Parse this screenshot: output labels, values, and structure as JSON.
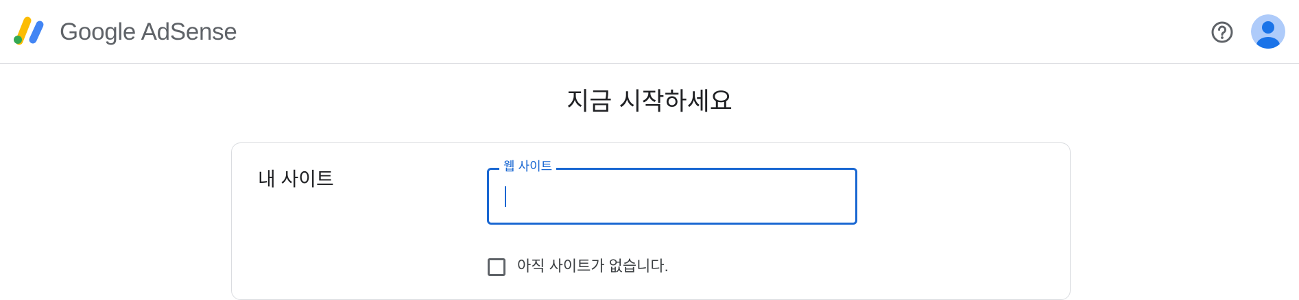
{
  "header": {
    "brand_google": "Google",
    "brand_product": "AdSense",
    "help_icon": "help-circle-icon",
    "avatar_icon": "account-avatar-icon"
  },
  "main": {
    "title": "지금 시작하세요"
  },
  "site_section": {
    "label": "내 사이트",
    "website_field": {
      "label": "웹 사이트",
      "value": "",
      "placeholder": ""
    },
    "no_site_checkbox": {
      "label": "아직 사이트가 없습니다.",
      "checked": false
    }
  },
  "colors": {
    "accent": "#1967d2",
    "logo_yellow": "#fbbc04",
    "logo_blue": "#4285f4",
    "logo_green": "#34a853",
    "avatar_bg": "#aecbfa",
    "avatar_fg": "#1a73e8"
  }
}
